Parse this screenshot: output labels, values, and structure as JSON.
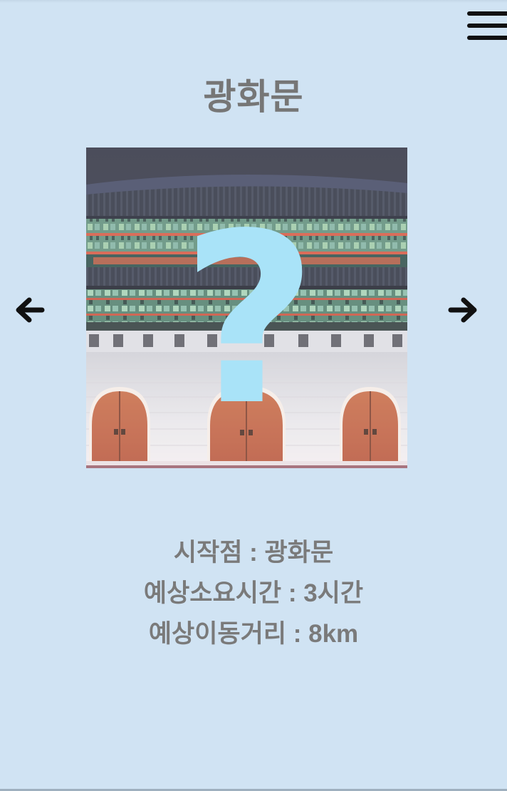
{
  "header": {
    "title": "광화문",
    "menu_icon": "hamburger-menu-icon"
  },
  "gallery": {
    "image_subject": "Gwanghwamun gate at night",
    "overlay_glyph": "?",
    "overlay_color": "#a9e3f8",
    "prev_icon": "arrow-left-icon",
    "next_icon": "arrow-right-icon"
  },
  "info": {
    "start_point": "시작점 : 광화문",
    "duration": "예상소요시간 : 3시간",
    "distance": "예상이동거리 : 8km"
  },
  "colors": {
    "background": "#d0e3f3",
    "title_text": "#767676",
    "info_text": "#7a7a7a"
  }
}
